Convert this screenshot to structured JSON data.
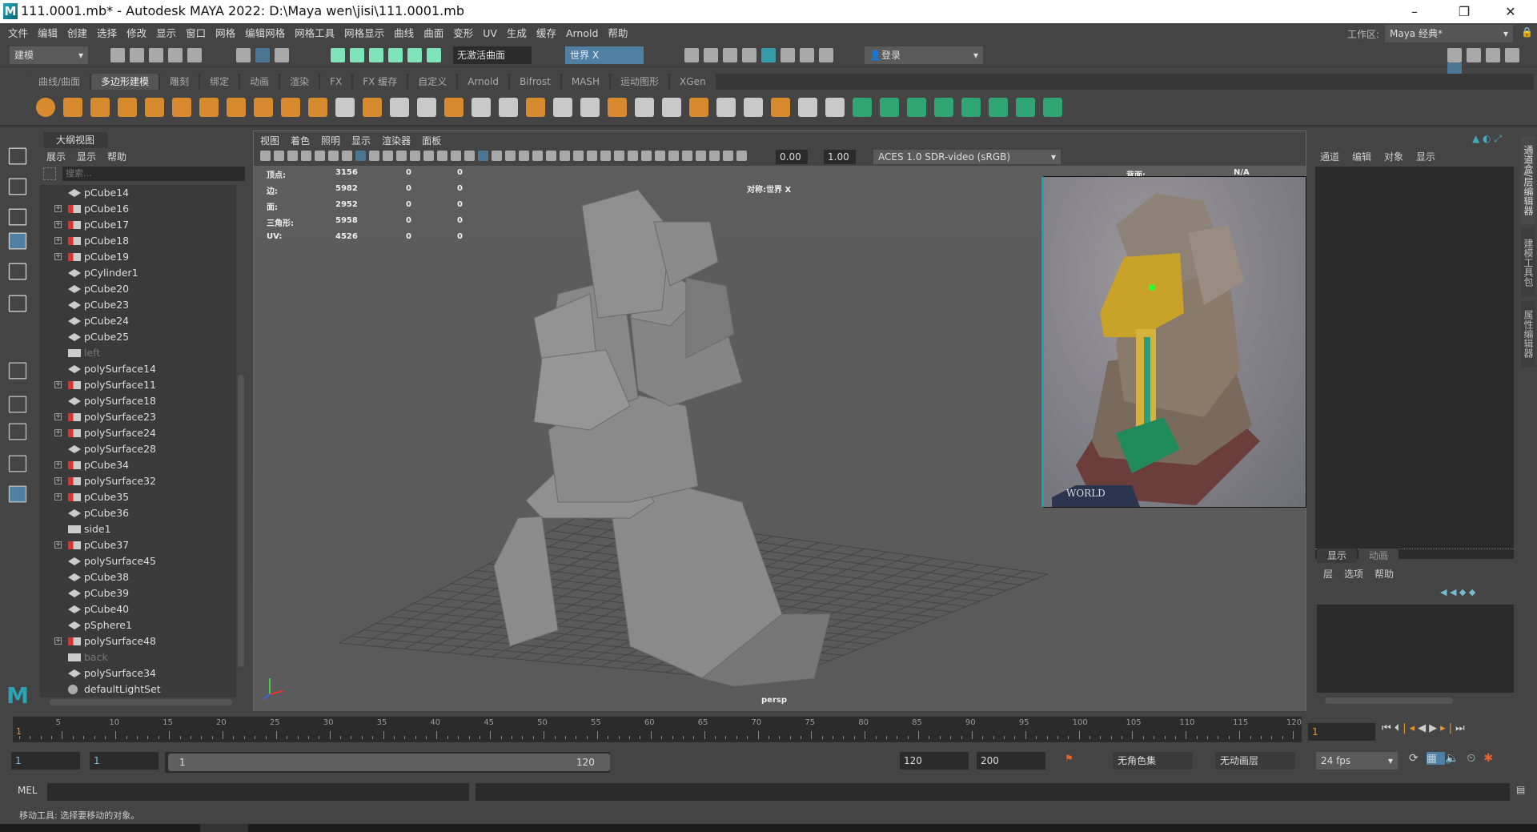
{
  "window": {
    "title": "111.0001.mb* - Autodesk MAYA 2022: D:\\Maya wen\\jisi\\111.0001.mb",
    "logo": "M",
    "minimize": "–",
    "maximize": "❐",
    "close": "✕"
  },
  "menubar": {
    "items": [
      "文件",
      "编辑",
      "创建",
      "选择",
      "修改",
      "显示",
      "窗口",
      "网格",
      "编辑网格",
      "网格工具",
      "网格显示",
      "曲线",
      "曲面",
      "变形",
      "UV",
      "生成",
      "缓存",
      "Arnold",
      "帮助"
    ],
    "workspace_label": "工作区:",
    "workspace_value": "Maya 经典*"
  },
  "statusline": {
    "mode": "建模",
    "live_surface": "无激活曲面",
    "symmetry": "世界 X",
    "login": "登录",
    "accent": "#4f7fa3"
  },
  "shelf": {
    "tabs": [
      "曲线/曲面",
      "多边形建模",
      "雕刻",
      "绑定",
      "动画",
      "渲染",
      "FX",
      "FX 缓存",
      "自定义",
      "Arnold",
      "Bifrost",
      "MASH",
      "运动图形",
      "XGen"
    ],
    "active_tab": 1,
    "icons": [
      "sphere-icon",
      "cube-icon",
      "cylinder-icon",
      "cone-icon",
      "torus-icon",
      "plane-icon",
      "disc-icon",
      "platonic-icon",
      "super-shape-icon",
      "type-icon",
      "svg-icon",
      "measure-icon",
      "bevel-icon",
      "snowflake-icon",
      "combine-icon",
      "separate-icon",
      "extract-icon",
      "boolean-icon",
      "smooth-icon",
      "mirror-icon",
      "extrude-icon",
      "bridge-icon",
      "append-icon",
      "fill-hole-icon",
      "multi-cut-icon",
      "target-weld-icon",
      "edge-loop-icon",
      "offset-loop-icon",
      "insert-loop-icon",
      "merge-icon",
      "uv-planar-icon",
      "uv-auto-icon",
      "uv-editor-icon",
      "uv-unfold-icon",
      "uv-layout-icon",
      "uv-checker-icon",
      "uv-cut-icon",
      "uv-sew-icon"
    ]
  },
  "toolbox": {
    "icons": [
      "select-tool-icon",
      "lasso-tool-icon",
      "paint-select-icon",
      "move-tool-icon",
      "rotate-tool-icon",
      "scale-tool-icon",
      "last-tool-icon",
      "single-pane-icon",
      "four-pane-icon",
      "two-pane-icon",
      "outliner-layout-icon"
    ]
  },
  "outliner": {
    "tab": "大纲视图",
    "menu": [
      "展示",
      "显示",
      "帮助"
    ],
    "search_placeholder": "搜索...",
    "items": [
      {
        "name": "pCube14",
        "type": "mesh"
      },
      {
        "name": "pCube16",
        "type": "group",
        "expandable": true
      },
      {
        "name": "pCube17",
        "type": "group",
        "expandable": true
      },
      {
        "name": "pCube18",
        "type": "group",
        "expandable": true
      },
      {
        "name": "pCube19",
        "type": "group",
        "expandable": true
      },
      {
        "name": "pCylinder1",
        "type": "mesh"
      },
      {
        "name": "pCube20",
        "type": "mesh"
      },
      {
        "name": "pCube23",
        "type": "mesh"
      },
      {
        "name": "pCube24",
        "type": "mesh"
      },
      {
        "name": "pCube25",
        "type": "mesh"
      },
      {
        "name": "left",
        "type": "camera",
        "dim": true
      },
      {
        "name": "polySurface14",
        "type": "mesh"
      },
      {
        "name": "polySurface11",
        "type": "group",
        "expandable": true
      },
      {
        "name": "polySurface18",
        "type": "mesh"
      },
      {
        "name": "polySurface23",
        "type": "group",
        "expandable": true
      },
      {
        "name": "polySurface24",
        "type": "group",
        "expandable": true
      },
      {
        "name": "polySurface28",
        "type": "mesh"
      },
      {
        "name": "pCube34",
        "type": "group",
        "expandable": true
      },
      {
        "name": "polySurface32",
        "type": "group",
        "expandable": true
      },
      {
        "name": "pCube35",
        "type": "group",
        "expandable": true
      },
      {
        "name": "pCube36",
        "type": "mesh"
      },
      {
        "name": "side1",
        "type": "camera"
      },
      {
        "name": "pCube37",
        "type": "group",
        "expandable": true
      },
      {
        "name": "polySurface45",
        "type": "mesh"
      },
      {
        "name": "pCube38",
        "type": "mesh"
      },
      {
        "name": "pCube39",
        "type": "mesh"
      },
      {
        "name": "pCube40",
        "type": "mesh"
      },
      {
        "name": "pSphere1",
        "type": "mesh"
      },
      {
        "name": "polySurface48",
        "type": "group",
        "expandable": true
      },
      {
        "name": "back",
        "type": "camera",
        "dim": true
      },
      {
        "name": "polySurface34",
        "type": "mesh"
      },
      {
        "name": "defaultLightSet",
        "type": "set"
      }
    ]
  },
  "viewport": {
    "menu": [
      "视图",
      "着色",
      "照明",
      "显示",
      "渲染器",
      "面板"
    ],
    "exposure": "0.00",
    "gamma": "1.00",
    "color_space": "ACES 1.0 SDR-video (sRGB)",
    "hud": {
      "rows": [
        {
          "label": "顶点:",
          "v": [
            "3156",
            "0",
            "0"
          ]
        },
        {
          "label": "边:",
          "v": [
            "5982",
            "0",
            "0"
          ]
        },
        {
          "label": "面:",
          "v": [
            "2952",
            "0",
            "0"
          ]
        },
        {
          "label": "三角形:",
          "v": [
            "5958",
            "0",
            "0"
          ]
        },
        {
          "label": "UV:",
          "v": [
            "4526",
            "0",
            "0"
          ]
        }
      ],
      "symmetry": "对称:世界 X",
      "backface_label": "背面:",
      "backface_value": "N/A",
      "camera": "persp"
    },
    "image_plane_logo": "WORLD WARCRAFT"
  },
  "channelbox": {
    "menu": [
      "通道",
      "编辑",
      "对象",
      "显示"
    ],
    "layer_tabs": [
      "显示",
      "动画"
    ],
    "layer_menu": [
      "层",
      "选项",
      "帮助"
    ],
    "side_tabs": [
      "通道盒/层编辑器",
      "建模工具包",
      "属性编辑器"
    ]
  },
  "timeline": {
    "tick_labels": [
      "5",
      "10",
      "15",
      "20",
      "25",
      "30",
      "35",
      "40",
      "45",
      "50",
      "55",
      "60",
      "65",
      "70",
      "75",
      "80",
      "85",
      "90",
      "95",
      "100",
      "105",
      "110",
      "115",
      "120"
    ],
    "start_marker": "1",
    "current_frame": "1"
  },
  "range": {
    "start": "1",
    "playback_start": "1",
    "slider_start": "1",
    "slider_end": "120",
    "playback_end": "120",
    "end": "200",
    "character_set": "无角色集",
    "anim_layer": "无动画层",
    "fps": "24 fps"
  },
  "mel": {
    "label": "MEL"
  },
  "help": {
    "text": "移动工具: 选择要移动的对象。"
  }
}
